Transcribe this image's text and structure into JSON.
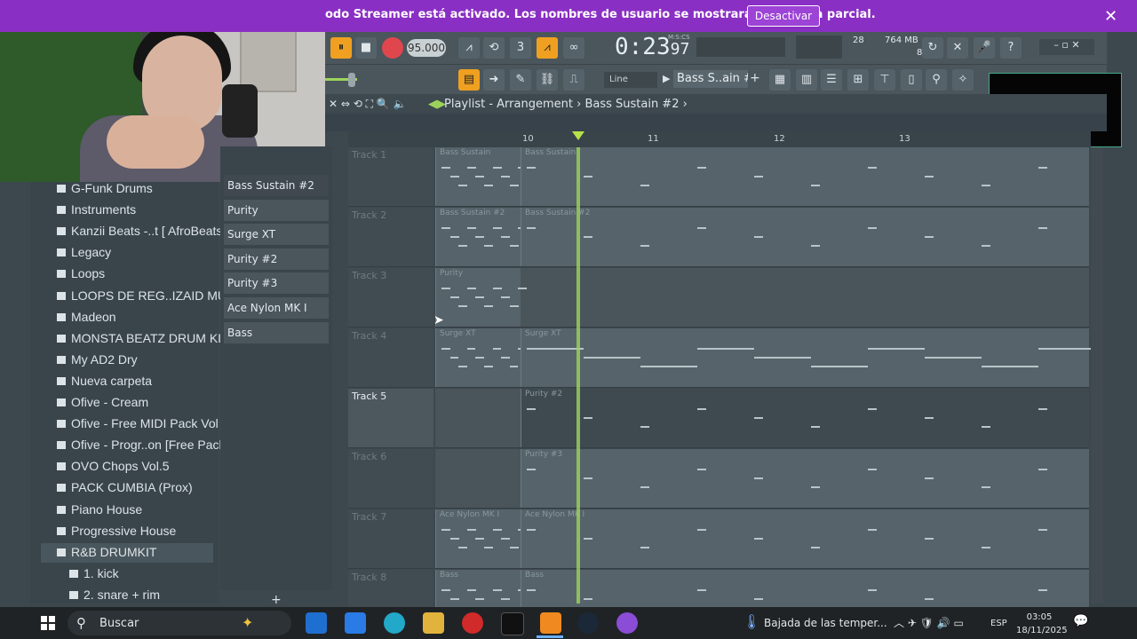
{
  "notification": {
    "text": "odo Streamer está activado. Los nombres de usuario se mostrarán de forma parcial.",
    "button": "Desactivar",
    "close": "✕"
  },
  "fl": {
    "tempo": "95.000",
    "timer": "0:23",
    "timer_frac": "97",
    "timer_sub": "M:S:CS",
    "cpu": "28",
    "memory": "764 MB",
    "polyphony": "8",
    "snap": "Line",
    "pattern": "Bass S..ain #2"
  },
  "browser": {
    "items": [
      "G-Funk Drums",
      "Instruments",
      "Kanzii Beats -..t [ AfroBeats ]",
      "Legacy",
      "Loops",
      "LOOPS DE REG..IZAID MUSIC",
      "Madeon",
      "MONSTA BEATZ DRUM KIT",
      "My AD2 Dry",
      "Nueva carpeta",
      "Ofive - Cream",
      "Ofive - Free MIDI Pack Vol 1",
      "Ofive - Progr..on [Free Pack]",
      "OVO Chops Vol.5",
      "PACK CUMBIA (Prox)",
      "Piano House",
      "Progressive House",
      "R&B DRUMKIT",
      "1. kick",
      "2. snare + rim"
    ]
  },
  "channels": [
    "Bass Sustain #2",
    "Purity",
    "Surge XT",
    "Purity #2",
    "Purity #3",
    "Ace Nylon MK I",
    "Bass"
  ],
  "playlist": {
    "breadcrumb": "Playlist - Arrangement",
    "pattern": "Bass Sustain #2",
    "bars": [
      "10",
      "11",
      "12",
      "13"
    ],
    "tracks": [
      {
        "name": "Track 1",
        "clips": [
          "Bass Sustain",
          "Bass Sustain"
        ]
      },
      {
        "name": "Track 2",
        "clips": [
          "Bass Sustain #2",
          "Bass Sustain #2"
        ]
      },
      {
        "name": "Track 3",
        "clips": [
          "Purity"
        ]
      },
      {
        "name": "Track 4",
        "clips": [
          "Surge XT",
          "Surge XT"
        ]
      },
      {
        "name": "Track 5",
        "clips": [
          "Purity #2"
        ]
      },
      {
        "name": "Track 6",
        "clips": [
          "Purity #3"
        ]
      },
      {
        "name": "Track 7",
        "clips": [
          "Ace Nylon MK I",
          "Ace Nylon MK I"
        ]
      },
      {
        "name": "Track 8",
        "clips": [
          "Bass",
          "Bass"
        ]
      }
    ]
  },
  "taskbar": {
    "search": "Buscar",
    "weather": "Bajada de las temper...",
    "lang": "ESP",
    "time": "03:05",
    "date": "18/11/2025"
  },
  "colors": {
    "notification_bg": "#8a2fc4",
    "playhead": "#9cd45a",
    "record": "#e0464e",
    "accent_orange": "#f0a020"
  }
}
